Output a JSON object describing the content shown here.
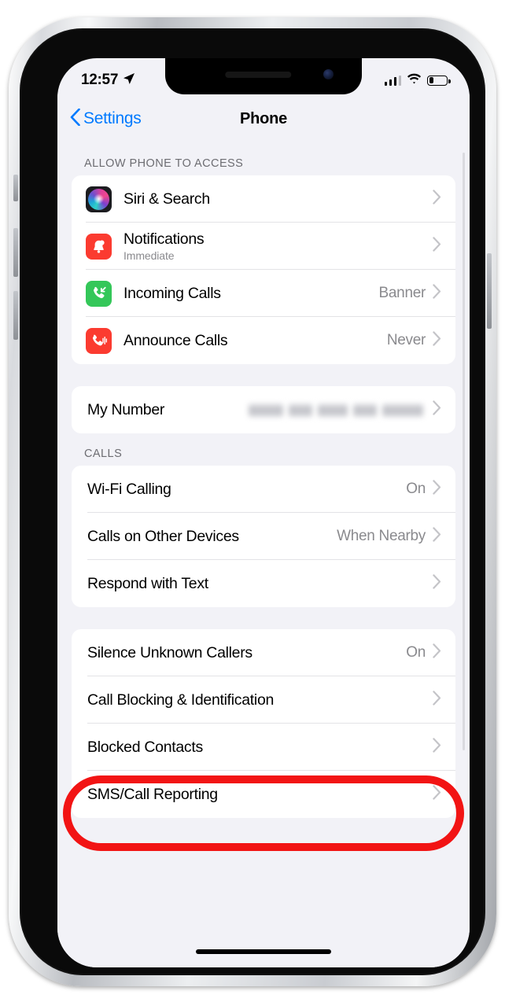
{
  "status_bar": {
    "time": "12:57",
    "location_icon": "location-arrow-icon",
    "signal_icon": "cellular-signal-icon",
    "wifi_icon": "wifi-icon",
    "battery_icon": "battery-icon"
  },
  "nav": {
    "back_label": "Settings",
    "back_icon": "chevron-left-icon",
    "title": "Phone"
  },
  "sections": [
    {
      "header": "ALLOW PHONE TO ACCESS",
      "rows": [
        {
          "title": "Siri & Search",
          "subtitle": "",
          "value": "",
          "icon": "siri-icon",
          "icon_style": "siri"
        },
        {
          "title": "Notifications",
          "subtitle": "Immediate",
          "value": "",
          "icon": "bell-icon",
          "icon_style": "red"
        },
        {
          "title": "Incoming Calls",
          "subtitle": "",
          "value": "Banner",
          "icon": "incoming-call-icon",
          "icon_style": "green"
        },
        {
          "title": "Announce Calls",
          "subtitle": "",
          "value": "Never",
          "icon": "announce-calls-icon",
          "icon_style": "red"
        }
      ]
    },
    {
      "header": "",
      "rows": [
        {
          "title": "My Number",
          "subtitle": "",
          "value": "",
          "redacted": true,
          "icon": "",
          "icon_style": ""
        }
      ]
    },
    {
      "header": "CALLS",
      "rows": [
        {
          "title": "Wi-Fi Calling",
          "subtitle": "",
          "value": "On",
          "icon": "",
          "icon_style": ""
        },
        {
          "title": "Calls on Other Devices",
          "subtitle": "",
          "value": "When Nearby",
          "icon": "",
          "icon_style": ""
        },
        {
          "title": "Respond with Text",
          "subtitle": "",
          "value": "",
          "icon": "",
          "icon_style": ""
        }
      ]
    },
    {
      "header": "",
      "rows": [
        {
          "title": "Silence Unknown Callers",
          "subtitle": "",
          "value": "On",
          "icon": "",
          "icon_style": "",
          "highlighted": true
        },
        {
          "title": "Call Blocking & Identification",
          "subtitle": "",
          "value": "",
          "icon": "",
          "icon_style": ""
        },
        {
          "title": "Blocked Contacts",
          "subtitle": "",
          "value": "",
          "icon": "",
          "icon_style": ""
        },
        {
          "title": "SMS/Call Reporting",
          "subtitle": "",
          "value": "",
          "icon": "",
          "icon_style": ""
        }
      ]
    }
  ],
  "annotation": {
    "shape": "rounded-rectangle",
    "color": "#f21414",
    "target": "Silence Unknown Callers"
  },
  "colors": {
    "accent_blue": "#007aff",
    "background": "#f2f2f7",
    "card": "#ffffff",
    "secondary_text": "#8a8a8e",
    "header_text": "#6d6d72",
    "icon_red": "#fb3b30",
    "icon_green": "#34c759",
    "annotation_red": "#f21414"
  }
}
